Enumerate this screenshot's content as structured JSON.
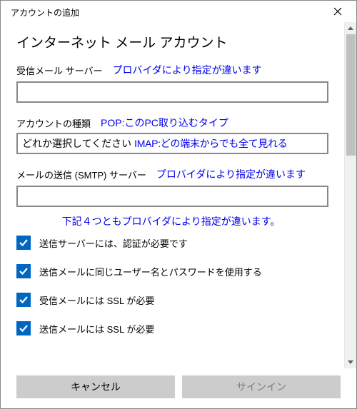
{
  "window_title": "アカウントの追加",
  "page_heading": "インターネット メール アカウント",
  "incoming": {
    "label": "受信メール サーバー",
    "note": "プロバイダにより指定が違います",
    "value": ""
  },
  "account_type": {
    "label": "アカウントの種類",
    "note": "POP:このPC取り込むタイプ",
    "select_placeholder": "どれか選択してください",
    "select_note": "IMAP:どの端末からでも全て見れる"
  },
  "smtp": {
    "label": "メールの送信 (SMTP) サーバー",
    "note": "プロバイダにより指定が違います",
    "value": ""
  },
  "group_note": "下記４つともプロバイダにより指定が違います。",
  "checks": {
    "auth_required": "送信サーバーには、認証が必要です",
    "same_credentials": "送信メールに同じユーザー名とパスワードを使用する",
    "incoming_ssl": "受信メールには SSL が必要",
    "outgoing_ssl": "送信メールには SSL が必要"
  },
  "buttons": {
    "cancel": "キャンセル",
    "signin": "サインイン"
  },
  "colors": {
    "accent": "#0067c0",
    "note_blue": "#0000ee"
  }
}
